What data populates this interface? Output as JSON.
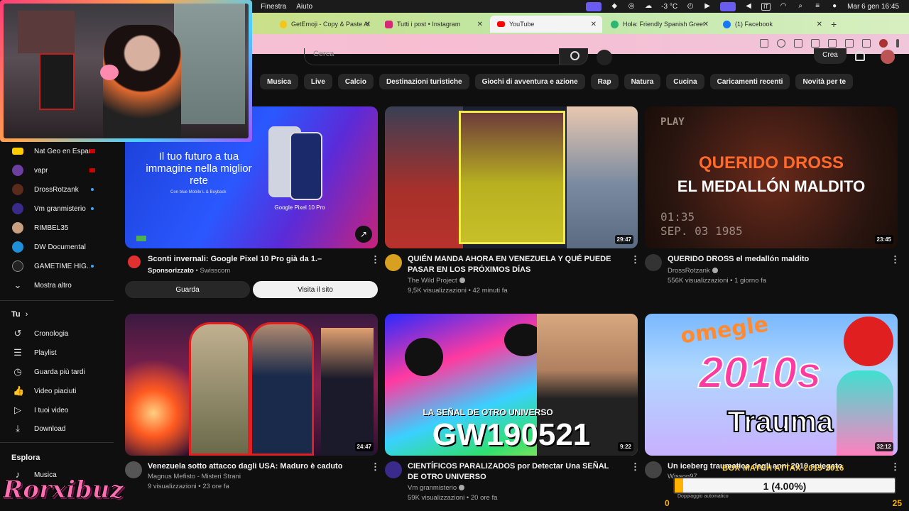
{
  "menubar": {
    "menus": [
      "da",
      "Finestra",
      "Aiuto"
    ],
    "temperature": "-3 °C",
    "lang": "IT",
    "clock": "Mar 6 gen  16:45"
  },
  "tabs": [
    {
      "label": "GetEmoji - Copy & Paste All E",
      "color": "#f5c518"
    },
    {
      "label": "Tutti i post • Instagram",
      "color": "#d62976"
    },
    {
      "label": "YouTube",
      "color": "#ff0000"
    },
    {
      "label": "Hola: Friendly Spanish Greet",
      "color": "#2bb673"
    },
    {
      "label": "(1) Facebook",
      "color": "#1877f2"
    }
  ],
  "search": {
    "placeholder": "Cerca"
  },
  "header": {
    "create_label": "Crea"
  },
  "chips": [
    "Musica",
    "Live",
    "Calcio",
    "Destinazioni turistiche",
    "Giochi di avventura e azione",
    "Rap",
    "Natura",
    "Cucina",
    "Caricamenti recenti",
    "Novità per te"
  ],
  "sidebar": {
    "subscriptions": [
      {
        "label": "Nat Geo en Españ...",
        "color": "#ffcc00",
        "indicator": "live"
      },
      {
        "label": "vapr",
        "color": "#6a3fa0",
        "indicator": "live"
      },
      {
        "label": "DrossRotzank",
        "color": "#5a2a1a",
        "indicator": "dot"
      },
      {
        "label": "Vm granmisterio",
        "color": "#3a2a8a",
        "indicator": "dot"
      },
      {
        "label": "RIMBEL35",
        "color": "#c8a080",
        "indicator": "none"
      },
      {
        "label": "DW Documental",
        "color": "#1f8fd8",
        "indicator": "none"
      },
      {
        "label": "GAMETIME HIG...",
        "color": "#222222",
        "indicator": "dot"
      }
    ],
    "show_more": "Mostra altro",
    "you_header": "Tu",
    "you_items": [
      {
        "label": "Cronologia",
        "icon": "history-icon"
      },
      {
        "label": "Playlist",
        "icon": "playlist-icon"
      },
      {
        "label": "Guarda più tardi",
        "icon": "watch-later-icon"
      },
      {
        "label": "Video piaciuti",
        "icon": "like-icon"
      },
      {
        "label": "I tuoi video",
        "icon": "your-videos-icon"
      },
      {
        "label": "Download",
        "icon": "download-icon"
      }
    ],
    "explore_header": "Esplora",
    "explore_items": [
      {
        "label": "Musica",
        "icon": "music-icon"
      }
    ]
  },
  "videos": [
    {
      "title": "Sconti invernali: Google Pixel 10 Pro già da 1.–",
      "channel": "Sponsorizzato",
      "channel_suffix": "Swisscom",
      "stats": "",
      "duration": "",
      "thumb_text_main": "Il tuo futuro a tua immagine nella miglior rete",
      "thumb_text_sub": "Con blue Mobile L & Buyback",
      "thumb_product": "Google Pixel 10 Pro",
      "ad_buttons": [
        "Guarda",
        "Visita il sito"
      ],
      "avatar_color": "#e03030"
    },
    {
      "title": "QUIÉN MANDA AHORA EN VENEZUELA Y QUÉ PUEDE PASAR EN LOS PRÓXIMOS DÍAS",
      "channel": "The Wild Project",
      "stats": "9,5K visualizzazioni • 42 minuti fa",
      "duration": "29:47",
      "avatar_color": "#d8a020"
    },
    {
      "title": "QUERIDO DROSS el medallón maldito",
      "channel": "DrossRotzank",
      "stats": "556K visualizzazioni • 1 giorno fa",
      "duration": "23:45",
      "thumb_line1": "QUERIDO DROSS",
      "thumb_line2": "EL MEDALLÓN MALDITO",
      "thumb_stamp": "PLAY",
      "thumb_time": "01:35",
      "thumb_date": "SEP. 03 1985",
      "avatar_color": "#333333"
    },
    {
      "title": "Venezuela sotto attacco dagli USA: Maduro è caduto",
      "channel": "Magnus Mefisto - Misteri Strani",
      "stats": "9 visualizzazioni • 23 ore fa",
      "duration": "24:47",
      "avatar_color": "#555555"
    },
    {
      "title": "CIENTÍFICOS PARALIZADOS por Detectar Una SEÑAL DE OTRO UNIVERSO",
      "channel": "Vm granmisterio",
      "stats": "59K visualizzazioni • 20 ore fa",
      "duration": "9:22",
      "thumb_line1": "LA SEÑAL DE OTRO UNIVERSO",
      "thumb_line2": "GW190521",
      "avatar_color": "#3a2a8a"
    },
    {
      "title": "Un iceberg traumatico degli anni 2010 spiegato",
      "channel": "Wisson97",
      "stats": "",
      "duration": "32:12",
      "thumb_line1": "omegle",
      "thumb_line2": "2010s",
      "thumb_line3": "Trauma",
      "avatar_color": "#444444"
    }
  ],
  "overlay": {
    "bet_title": "BOX MATCH ATTAX 2015-2016",
    "bet_value": "1 (4.00%)",
    "bet_fraction": 0.04,
    "bet_min": "0",
    "bet_max": "25",
    "bet_note": "Doppiaggio automatico",
    "streamer": "Rorxibuz"
  }
}
